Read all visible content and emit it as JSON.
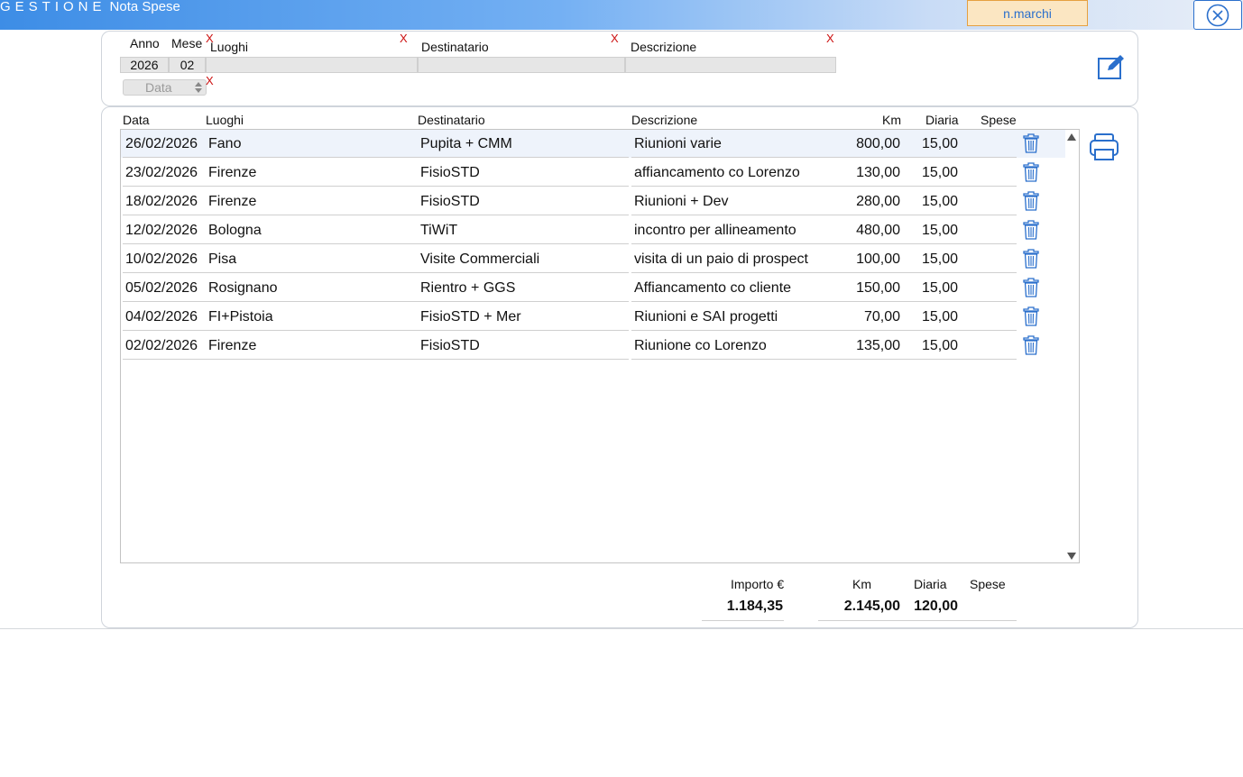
{
  "header": {
    "brand": "GESTIONE",
    "section": "Nota Spese",
    "user": "n.marchi"
  },
  "filters": {
    "anno_label": "Anno",
    "mese_label": "Mese",
    "luoghi_label": "Luoghi",
    "destinatario_label": "Destinatario",
    "descrizione_label": "Descrizione",
    "anno_value": "2026",
    "mese_value": "02",
    "luoghi_value": "",
    "destinatario_value": "",
    "descrizione_value": "",
    "data_placeholder": "Data",
    "clear_mark": "X"
  },
  "table": {
    "columns": {
      "data": "Data",
      "luoghi": "Luoghi",
      "destinatario": "Destinatario",
      "descrizione": "Descrizione",
      "km": "Km",
      "diaria": "Diaria",
      "spese": "Spese"
    },
    "rows": [
      {
        "data": "26/02/2026",
        "luoghi": "Fano",
        "destinatario": "Pupita + CMM",
        "descrizione": "Riunioni varie",
        "km": "800,00",
        "diaria": "15,00",
        "spese": ""
      },
      {
        "data": "23/02/2026",
        "luoghi": "Firenze",
        "destinatario": "FisioSTD",
        "descrizione": "affiancamento co Lorenzo",
        "km": "130,00",
        "diaria": "15,00",
        "spese": ""
      },
      {
        "data": "18/02/2026",
        "luoghi": "Firenze",
        "destinatario": "FisioSTD",
        "descrizione": "Riunioni + Dev",
        "km": "280,00",
        "diaria": "15,00",
        "spese": ""
      },
      {
        "data": "12/02/2026",
        "luoghi": "Bologna",
        "destinatario": "TiWiT",
        "descrizione": "incontro per allineamento",
        "km": "480,00",
        "diaria": "15,00",
        "spese": ""
      },
      {
        "data": "10/02/2026",
        "luoghi": "Pisa",
        "destinatario": "Visite Commerciali",
        "descrizione": "visita di un paio di prospect",
        "km": "100,00",
        "diaria": "15,00",
        "spese": ""
      },
      {
        "data": "05/02/2026",
        "luoghi": "Rosignano",
        "destinatario": "Rientro + GGS",
        "descrizione": "Affiancamento co cliente",
        "km": "150,00",
        "diaria": "15,00",
        "spese": ""
      },
      {
        "data": "04/02/2026",
        "luoghi": "FI+Pistoia",
        "destinatario": "FisioSTD + Mer",
        "descrizione": "Riunioni e SAI progetti",
        "km": "70,00",
        "diaria": "15,00",
        "spese": ""
      },
      {
        "data": "02/02/2026",
        "luoghi": "Firenze",
        "destinatario": "FisioSTD",
        "descrizione": "Riunione co Lorenzo",
        "km": "135,00",
        "diaria": "15,00",
        "spese": ""
      }
    ]
  },
  "totals": {
    "importo_label": "Importo €",
    "km_label": "Km",
    "diaria_label": "Diaria",
    "spese_label": "Spese",
    "importo": "1.184,35",
    "km": "2.145,00",
    "diaria": "120,00",
    "spese": ""
  },
  "colors": {
    "accent": "#2a6fcc",
    "clear_x": "#cc1111",
    "user_badge_bg": "#fbe6c2",
    "user_badge_border": "#e5a040"
  },
  "icons": {
    "close": "close-circle-icon",
    "edit": "edit-icon",
    "print": "print-icon",
    "delete": "trash-icon",
    "spinner": "spinner-icon",
    "scroll_up": "scroll-up-arrow-icon",
    "scroll_down": "scroll-down-arrow-icon"
  }
}
